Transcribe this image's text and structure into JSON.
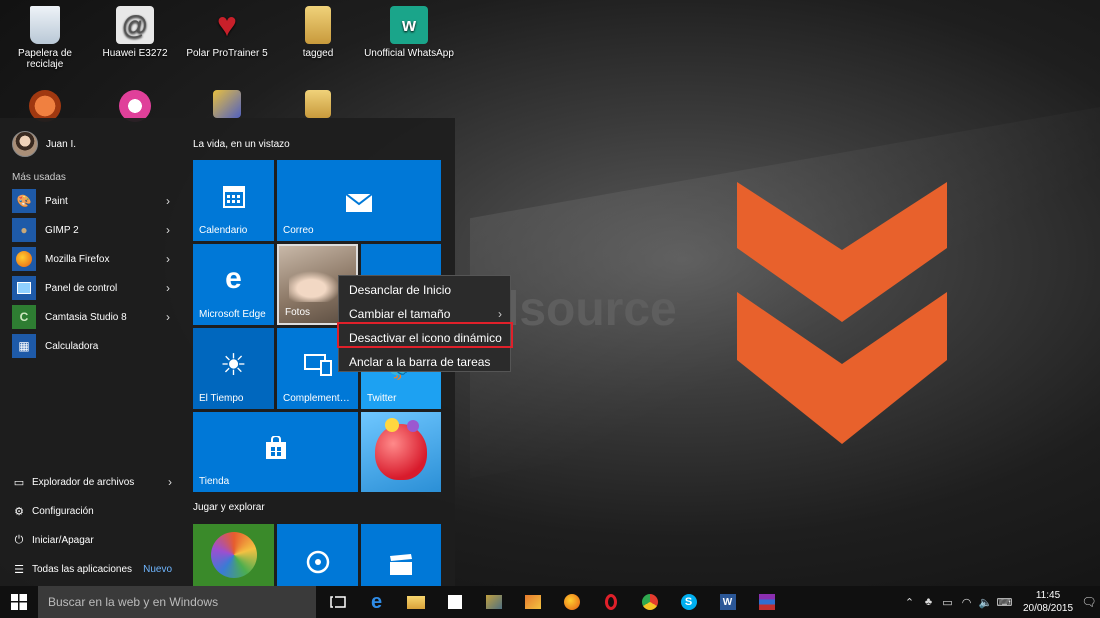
{
  "desktop": {
    "icons": [
      {
        "label": "Papelera de reciclaje",
        "icon": "recycle-bin-icon",
        "color": "#d0dce8"
      },
      {
        "label": "Huawei E3272",
        "icon": "at-sign-icon",
        "color": "#e8e8e8"
      },
      {
        "label": "Polar ProTrainer 5",
        "icon": "heart-icon",
        "color": "#c8202a"
      },
      {
        "label": "tagged",
        "icon": "folder-icon",
        "color": "#e8c060"
      },
      {
        "label": "Unofficial WhatsApp",
        "icon": "whatsapp-icon",
        "color": "#1aa58a"
      }
    ],
    "row2_icons": [
      {
        "icon": "paw-icon",
        "color": "#e06020"
      },
      {
        "icon": "itunes-icon",
        "color": "#e0409a"
      },
      {
        "icon": "audio-tool-icon",
        "color": "#5060c0"
      },
      {
        "icon": "folder-icon",
        "color": "#e8c060"
      }
    ],
    "wallpaper_text": "dsource",
    "accent": "#e8612c"
  },
  "start_menu": {
    "user_name": "Juan I.",
    "most_used_label": "Más usadas",
    "apps": [
      {
        "label": "Paint",
        "has_arrow": true
      },
      {
        "label": "GIMP 2",
        "has_arrow": true
      },
      {
        "label": "Mozilla Firefox",
        "has_arrow": true
      },
      {
        "label": "Panel de control",
        "has_arrow": true
      },
      {
        "label": "Camtasia Studio 8",
        "has_arrow": true
      },
      {
        "label": "Calculadora",
        "has_arrow": false
      }
    ],
    "system": {
      "explorer": "Explorador de archivos",
      "settings": "Configuración",
      "power": "Iniciar/Apagar",
      "all_apps": "Todas las aplicaciones",
      "new_badge": "Nuevo"
    },
    "group1_label": "La vida, en un vistazo",
    "group2_label": "Jugar y explorar",
    "tiles": {
      "calendar": "Calendario",
      "mail": "Correo",
      "edge": "Microsoft Edge",
      "photos": "Fotos",
      "weather": "El Tiempo",
      "companion": "Complement…",
      "twitter": "Twitter",
      "store": "Tienda"
    },
    "tile_color": "#0078d7"
  },
  "context_menu": {
    "items": [
      {
        "label": "Desanclar de Inicio",
        "has_arrow": false
      },
      {
        "label": "Cambiar el tamaño",
        "has_arrow": true
      },
      {
        "label": "Desactivar el icono dinámico",
        "has_arrow": false
      },
      {
        "label": "Anclar a la barra de tareas",
        "has_arrow": false
      }
    ],
    "highlight_color": "#e0202a"
  },
  "taskbar": {
    "search_placeholder": "Buscar en la web y en Windows",
    "time": "11:45",
    "date": "20/08/2015"
  }
}
